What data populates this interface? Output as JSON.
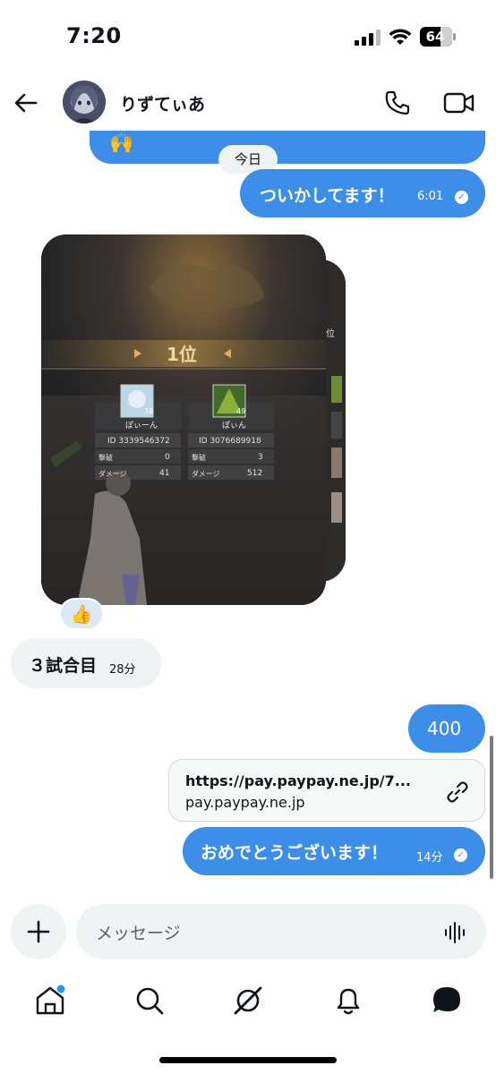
{
  "status_bar": {
    "time": "7:20",
    "battery": "64"
  },
  "header": {
    "contact_name": "りずてぃあ"
  },
  "messages": {
    "date_chip": "今日",
    "prev_emoji": "🙌",
    "msg1": {
      "text": "ついかしてます！",
      "time": "6:01"
    },
    "image": {
      "rank_label": "1位",
      "side_rank_label": "位",
      "players": [
        {
          "name": "ぽぃーん",
          "level": "38",
          "id": "ID 3339546372",
          "kills_label": "撃破",
          "kills": "0",
          "damage_label": "ダメージ",
          "damage": "41"
        },
        {
          "name": "ぽぃん",
          "level": "49",
          "id": "ID 3076689918",
          "kills_label": "撃破",
          "kills": "3",
          "damage_label": "ダメージ",
          "damage": "512"
        }
      ]
    },
    "reaction": "👍",
    "msg2": {
      "text": "３試合目",
      "time": "28分"
    },
    "msg3": {
      "text": "400"
    },
    "link": {
      "url": "https://pay.paypay.ne.jp/7...",
      "domain": "pay.paypay.ne.jp"
    },
    "msg4": {
      "text": "おめでとうございます！",
      "time": "14分"
    }
  },
  "composer": {
    "placeholder": "メッセージ"
  },
  "colors": {
    "accent": "#3d8ee8",
    "incoming_bubble": "#eff3f4",
    "notification_dot": "#1d9bf0"
  },
  "icons": [
    "back-arrow-icon",
    "phone-icon",
    "video-icon",
    "link-icon",
    "voice-icon",
    "home-icon",
    "search-icon",
    "grok-icon",
    "bell-icon",
    "messages-icon"
  ]
}
